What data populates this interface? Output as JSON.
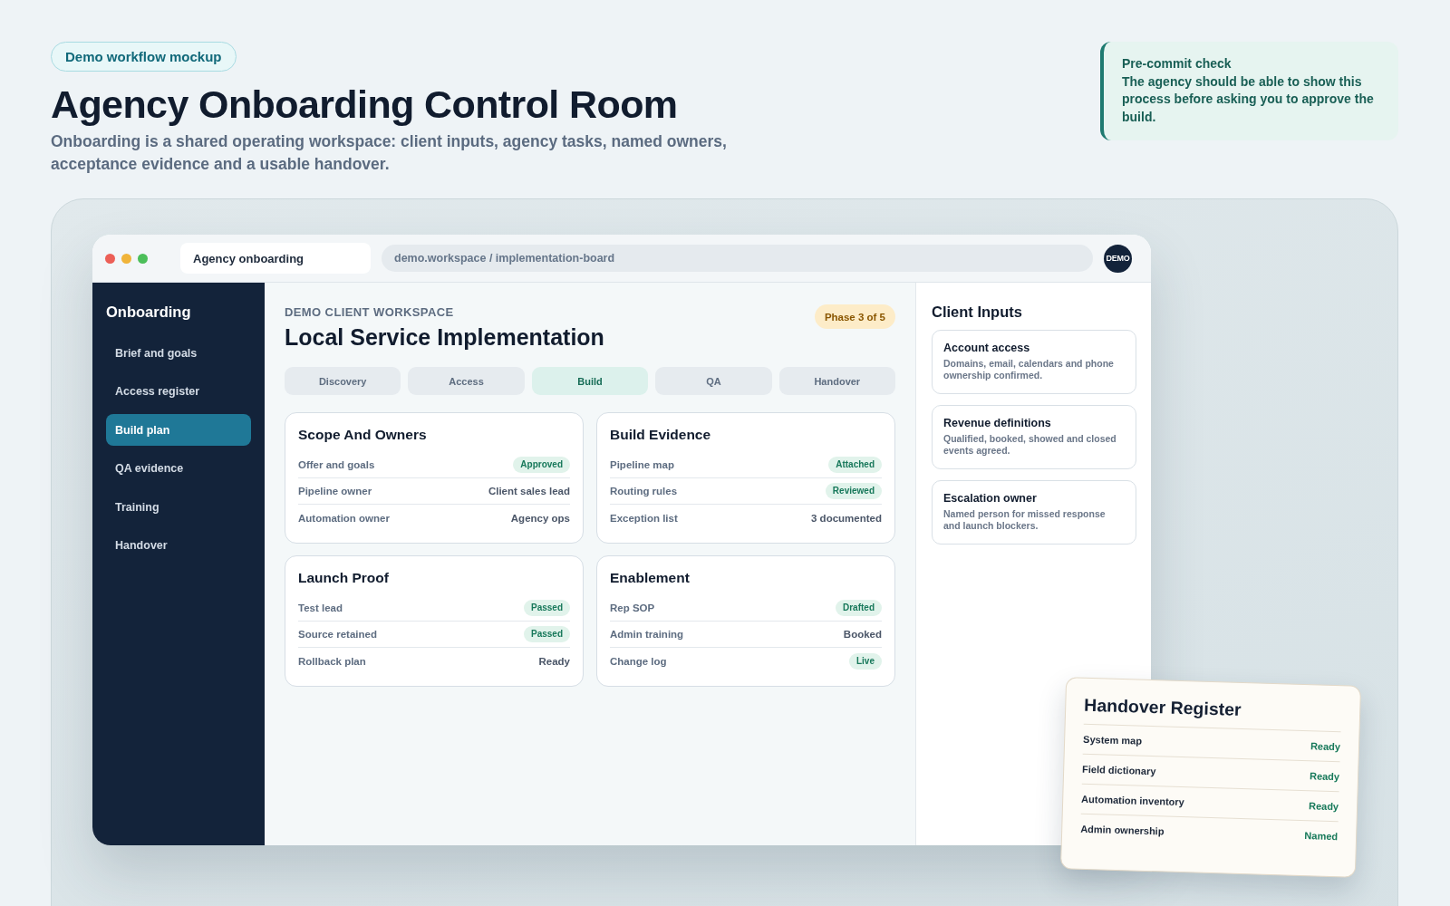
{
  "header": {
    "badge": "Demo workflow mockup",
    "title": "Agency Onboarding Control Room",
    "subtitle": "Onboarding is a shared operating workspace: client inputs, agency tasks, named owners, acceptance evidence and a usable handover."
  },
  "callout": {
    "title": "Pre-commit check",
    "text": "The agency should be able to show this process before asking you to approve the build."
  },
  "browser": {
    "tab": "Agency onboarding",
    "address": "demo.workspace / implementation-board",
    "avatar": "DEMO"
  },
  "sidebar": {
    "title": "Onboarding",
    "items": [
      {
        "label": "Brief and goals",
        "selected": false
      },
      {
        "label": "Access register",
        "selected": false
      },
      {
        "label": "Build plan",
        "selected": true
      },
      {
        "label": "QA evidence",
        "selected": false
      },
      {
        "label": "Training",
        "selected": false
      },
      {
        "label": "Handover",
        "selected": false
      }
    ]
  },
  "workspace": {
    "eyebrow": "DEMO CLIENT WORKSPACE",
    "title": "Local Service Implementation",
    "phase": "Phase 3 of 5",
    "tabs": [
      {
        "label": "Discovery",
        "selected": false
      },
      {
        "label": "Access",
        "selected": false
      },
      {
        "label": "Build",
        "selected": true
      },
      {
        "label": "QA",
        "selected": false
      },
      {
        "label": "Handover",
        "selected": false
      }
    ],
    "cards": [
      {
        "title": "Scope And Owners",
        "rows": [
          {
            "label": "Offer and goals",
            "value": "Approved",
            "kind": "status"
          },
          {
            "label": "Pipeline owner",
            "value": "Client sales lead",
            "kind": "text"
          },
          {
            "label": "Automation owner",
            "value": "Agency ops",
            "kind": "text"
          }
        ]
      },
      {
        "title": "Build Evidence",
        "rows": [
          {
            "label": "Pipeline map",
            "value": "Attached",
            "kind": "status"
          },
          {
            "label": "Routing rules",
            "value": "Reviewed",
            "kind": "status"
          },
          {
            "label": "Exception list",
            "value": "3 documented",
            "kind": "text"
          }
        ]
      },
      {
        "title": "Launch Proof",
        "rows": [
          {
            "label": "Test lead",
            "value": "Passed",
            "kind": "status"
          },
          {
            "label": "Source retained",
            "value": "Passed",
            "kind": "status"
          },
          {
            "label": "Rollback plan",
            "value": "Ready",
            "kind": "text"
          }
        ]
      },
      {
        "title": "Enablement",
        "rows": [
          {
            "label": "Rep SOP",
            "value": "Drafted",
            "kind": "status"
          },
          {
            "label": "Admin training",
            "value": "Booked",
            "kind": "text"
          },
          {
            "label": "Change log",
            "value": "Live",
            "kind": "status"
          }
        ]
      }
    ]
  },
  "client_inputs": {
    "title": "Client Inputs",
    "items": [
      {
        "title": "Account access",
        "text": "Domains, email, calendars and phone ownership confirmed."
      },
      {
        "title": "Revenue definitions",
        "text": "Qualified, booked, showed and closed events agreed."
      },
      {
        "title": "Escalation owner",
        "text": "Named person for missed response and launch blockers."
      }
    ]
  },
  "handover_register": {
    "title": "Handover Register",
    "rows": [
      {
        "label": "System map",
        "value": "Ready"
      },
      {
        "label": "Field dictionary",
        "value": "Ready"
      },
      {
        "label": "Automation inventory",
        "value": "Ready"
      },
      {
        "label": "Admin ownership",
        "value": "Named"
      }
    ]
  }
}
